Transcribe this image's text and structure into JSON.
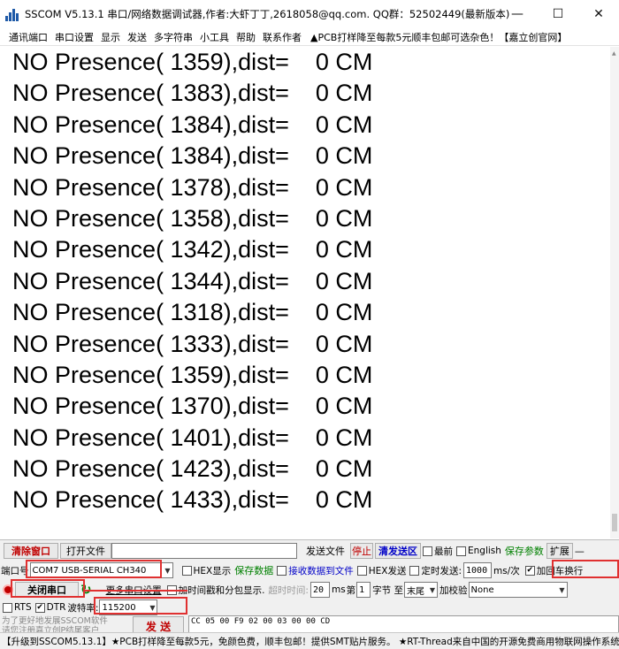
{
  "window": {
    "title": "SSCOM V5.13.1 串口/网络数据调试器,作者:大虾丁丁,2618058@qq.com. QQ群：52502449(最新版本)",
    "minimize": "—",
    "maximize": "☐",
    "close": "✕"
  },
  "menu": {
    "items": [
      "通讯端口",
      "串口设置",
      "显示",
      "发送",
      "多字符串",
      "小工具",
      "帮助",
      "联系作者"
    ],
    "ad": "▲PCB打样降至每款5元顺丰包邮可选杂色！【嘉立创官网】"
  },
  "output": {
    "lines": [
      "NO Presence( 1359),dist=    0 CM",
      "NO Presence( 1383),dist=    0 CM",
      "NO Presence( 1384),dist=    0 CM",
      "NO Presence( 1384),dist=    0 CM",
      "NO Presence( 1378),dist=    0 CM",
      "NO Presence( 1358),dist=    0 CM",
      "NO Presence( 1342),dist=    0 CM",
      "NO Presence( 1344),dist=    0 CM",
      "NO Presence( 1318),dist=    0 CM",
      "NO Presence( 1333),dist=    0 CM",
      "NO Presence( 1359),dist=    0 CM",
      "NO Presence( 1370),dist=    0 CM",
      "NO Presence( 1401),dist=    0 CM",
      "NO Presence( 1423),dist=    0 CM",
      "NO Presence( 1433),dist=    0 CM"
    ]
  },
  "toolbar": {
    "clear_window": "清除窗口",
    "open_file": "打开文件",
    "file_path": "",
    "send_file": "发送文件",
    "stop": "停止",
    "clear_send": "清发送区",
    "latest": "最前",
    "english": "English",
    "save_params": "保存参数",
    "expand": "扩展",
    "dash": "—"
  },
  "port": {
    "label": "端口号",
    "value": "COM7 USB-SERIAL CH340",
    "hex_display": "HEX显示",
    "save_data": "保存数据",
    "recv_to_file": "接收数据到文件",
    "hex_send": "HEX发送",
    "timed_send": "定时发送:",
    "interval": "1000",
    "interval_unit": "ms/次",
    "add_crlf": "加回车换行"
  },
  "conn": {
    "close_port": "关闭串口",
    "more_settings": "更多串口设置",
    "timestamp": "加时间戳和分包显示.",
    "timeout_label": "超时时间:",
    "timeout_value": "20",
    "timeout_unit": "ms",
    "byte_label": "第",
    "byte_value": "1",
    "byte_unit": "字节 至",
    "tail": "末尾",
    "checksum_label": "加校验",
    "checksum_value": "None"
  },
  "flow": {
    "rts": "RTS",
    "dtr": "DTR",
    "baud_label": "波特率:",
    "baud_value": "115200",
    "send_hex": "CC 05 00 F9 02 00 03 00 00 CD"
  },
  "promo": {
    "line1": "为了更好地发展SSCOM软件",
    "line2": "请您注册嘉立创P结尾客户",
    "send": "发 送"
  },
  "status": {
    "text": "【升级到SSCOM5.13.1】★PCB打样降至每款5元，免颜色费，顺丰包邮！提供SMT贴片服务。 ★RT-Thread来自中国的开源免费商用物联网操作系统"
  },
  "colors": {
    "highlight_box": "#e03030",
    "accent_red": "#c00000",
    "accent_green": "#008000",
    "accent_blue": "#0000c8"
  }
}
